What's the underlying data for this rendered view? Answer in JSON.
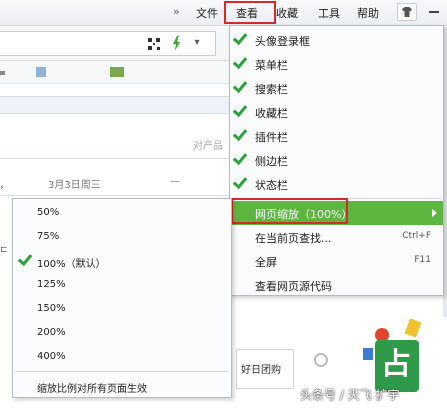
{
  "menubar": {
    "overflow": "»",
    "items": [
      "文件",
      "查看",
      "收藏",
      "工具",
      "帮助"
    ]
  },
  "address_bar": {
    "dropdown": "▾"
  },
  "background": {
    "text_fragment_1": "对产品",
    "text_fragment_2": "3月3日周三",
    "dash": "—",
    "marker_1": "›",
    "marker_2": "⊏",
    "deal_text": "好日团购"
  },
  "view_menu": {
    "items": [
      {
        "label": "头像登录框",
        "checked": true
      },
      {
        "label": "菜单栏",
        "checked": true
      },
      {
        "label": "搜索栏",
        "checked": true
      },
      {
        "label": "收藏栏",
        "checked": true
      },
      {
        "label": "插件栏",
        "checked": true
      },
      {
        "label": "侧边栏",
        "checked": true
      },
      {
        "label": "状态栏",
        "checked": true
      }
    ],
    "zoom": {
      "label": "网页缩放（100%）"
    },
    "find": {
      "label": "在当前页查找...",
      "shortcut": "Ctrl+F"
    },
    "fullscreen": {
      "label": "全屏",
      "shortcut": "F11"
    },
    "view_source": {
      "label": "查看网页源代码"
    }
  },
  "zoom_menu": {
    "items": [
      {
        "label": "50%",
        "checked": false
      },
      {
        "label": "75%",
        "checked": false
      },
      {
        "label": "100%（默认）",
        "checked": true
      },
      {
        "label": "125%",
        "checked": false
      },
      {
        "label": "150%",
        "checked": false
      },
      {
        "label": "200%",
        "checked": false
      },
      {
        "label": "400%",
        "checked": false
      }
    ],
    "apply_all": "缩放比例对所有页面生效"
  },
  "festive_glyph": "占",
  "watermark": "头条号 / 天飞 扩宇",
  "colors": {
    "accent_green": "#5db640",
    "check_green": "#29a43a",
    "highlight_red": "#d42a2a"
  }
}
